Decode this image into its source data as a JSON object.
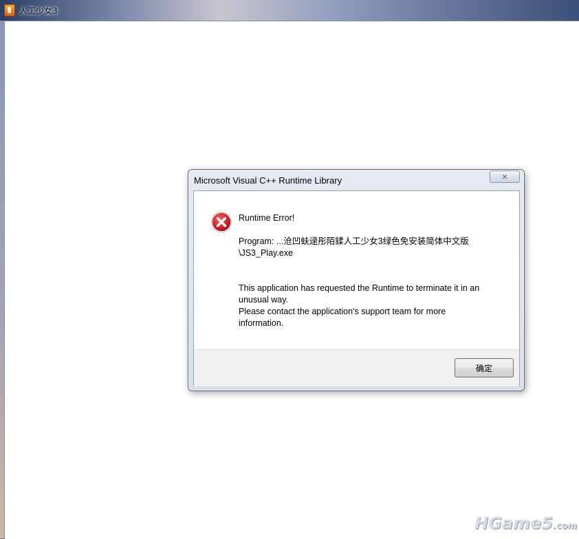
{
  "app": {
    "title": "人工少女3"
  },
  "dialog": {
    "title": "Microsoft Visual C++ Runtime Library",
    "close_glyph": "✕",
    "icon": "error-icon",
    "heading": "Runtime Error!",
    "program_line1": "Program: ...沧凹蚨逯彤陌鍒人工少女3绿色免安装简体中文版",
    "program_line2": "\\JS3_Play.exe",
    "message_line1": "This application has requested the Runtime to terminate it in an",
    "message_line2": "unusual way.",
    "message_line3": "Please contact the application's support team for more",
    "message_line4": "information.",
    "ok_label": "确定"
  },
  "watermark": {
    "text": "HGame5",
    "suffix": ".com"
  },
  "colors": {
    "error_red": "#d9252b",
    "dialog_frame": "#d7dfea",
    "footer": "#f0f0f0"
  }
}
